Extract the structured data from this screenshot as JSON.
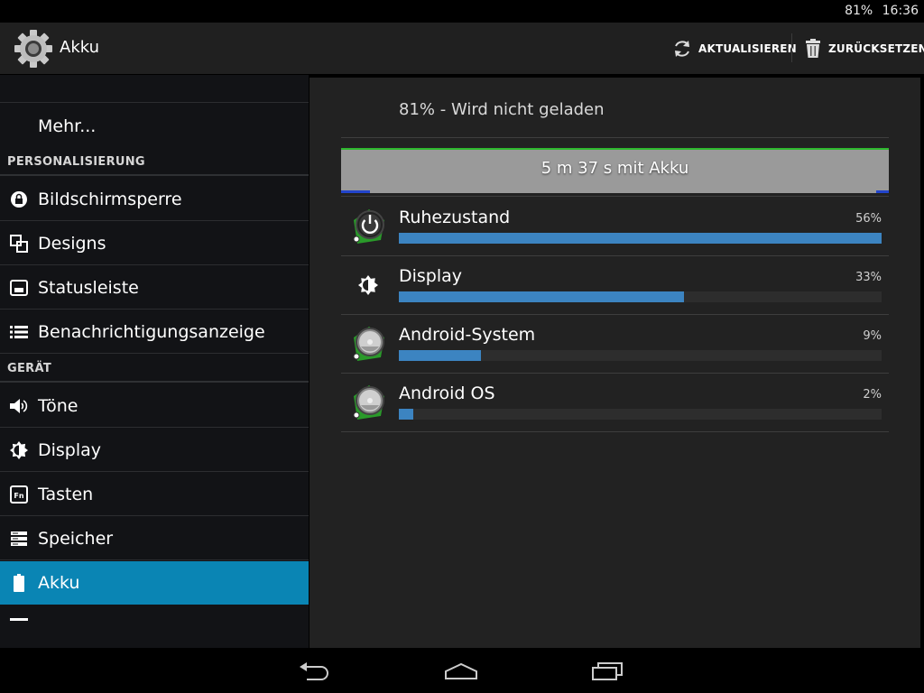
{
  "status_bar": {
    "battery": "81%",
    "time": "16:36"
  },
  "action_bar": {
    "title": "Akku",
    "actions": {
      "refresh": "AKTUALISIEREN",
      "reset": "ZURÜCKSETZEN"
    }
  },
  "sidebar": {
    "items": [
      {
        "label": "Mehr...",
        "icon": "none"
      },
      {
        "header": "PERSONALISIERUNG"
      },
      {
        "label": "Bildschirmsperre",
        "icon": "lock-icon"
      },
      {
        "label": "Designs",
        "icon": "themes-icon"
      },
      {
        "label": "Statusleiste",
        "icon": "statusbar-icon"
      },
      {
        "label": "Benachrichtigungsanzeige",
        "icon": "list-icon"
      },
      {
        "header": "GERÄT"
      },
      {
        "label": "Töne",
        "icon": "speaker-icon"
      },
      {
        "label": "Display",
        "icon": "brightness-icon"
      },
      {
        "label": "Tasten",
        "icon": "fn-key-icon"
      },
      {
        "label": "Speicher",
        "icon": "storage-icon"
      },
      {
        "label": "Akku",
        "icon": "battery-icon",
        "selected": true
      }
    ]
  },
  "battery": {
    "status": "81% - Wird nicht geladen",
    "time_on_battery": "5 m 37 s mit Akku",
    "usage": [
      {
        "name": "Ruhezustand",
        "percent_text": "56%",
        "fill": 1.0,
        "icon": "power-icon"
      },
      {
        "name": "Display",
        "percent_text": "33%",
        "fill": 0.59,
        "icon": "brightness-icon"
      },
      {
        "name": "Android-System",
        "percent_text": "9%",
        "fill": 0.17,
        "icon": "android-system-icon"
      },
      {
        "name": "Android OS",
        "percent_text": "2%",
        "fill": 0.03,
        "icon": "android-os-icon"
      }
    ]
  },
  "colors": {
    "accent": "#0a85b4",
    "usage_bar": "#3c84c1",
    "graph_line": "#2eb82e"
  },
  "navigation": {
    "buttons": [
      "back-icon",
      "home-icon",
      "recents-icon"
    ]
  }
}
